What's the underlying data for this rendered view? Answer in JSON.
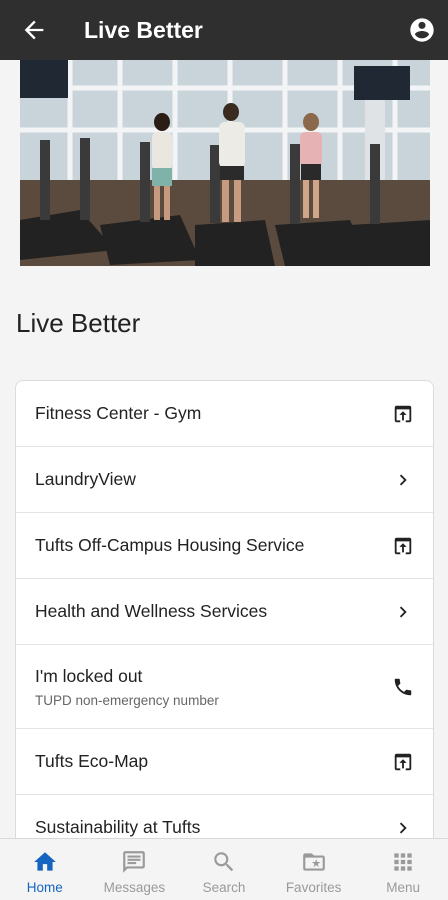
{
  "header": {
    "title": "Live Better",
    "back_icon": "arrow-back-icon",
    "account_icon": "account-circle-icon"
  },
  "page": {
    "title": "Live Better"
  },
  "items": [
    {
      "label": "Fitness Center - Gym",
      "icon": "open-external-icon"
    },
    {
      "label": "LaundryView",
      "icon": "chevron-right-icon"
    },
    {
      "label": "Tufts Off-Campus Housing Service",
      "icon": "open-external-icon"
    },
    {
      "label": "Health and Wellness Services",
      "icon": "chevron-right-icon"
    },
    {
      "label": "I'm locked out",
      "sublabel": "TUPD non-emergency number",
      "icon": "phone-icon"
    },
    {
      "label": "Tufts Eco-Map",
      "icon": "open-external-icon"
    },
    {
      "label": "Sustainability at Tufts",
      "icon": "chevron-right-icon"
    }
  ],
  "nav": {
    "tabs": [
      {
        "label": "Home",
        "icon": "home-icon",
        "active": true
      },
      {
        "label": "Messages",
        "icon": "message-icon"
      },
      {
        "label": "Search",
        "icon": "search-icon"
      },
      {
        "label": "Favorites",
        "icon": "favorites-folder-icon"
      },
      {
        "label": "Menu",
        "icon": "grid-menu-icon"
      }
    ]
  },
  "colors": {
    "appbar": "#2f2f2f",
    "accent": "#1565c0",
    "inactive": "#9a9a9a"
  }
}
